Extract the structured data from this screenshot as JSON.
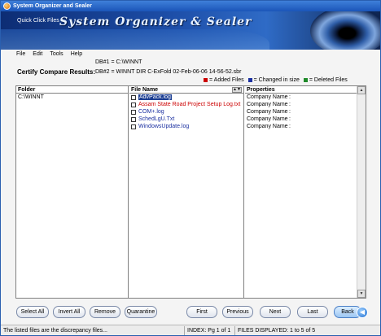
{
  "window": {
    "title": "System Organizer and Sealer"
  },
  "banner": {
    "quick_click_files": "Quick Click Files",
    "brand": "System Organizer & Sealer"
  },
  "menu": [
    "File",
    "Edit",
    "Tools",
    "Help"
  ],
  "info": {
    "db1": "DB#1 = C:\\WINNT",
    "db2": "DB#2 = WINNT DIR C-ExFold 02-Feb-06-06  14-56-52.sbr",
    "certify_label": "Certify Compare Results:",
    "legend": [
      {
        "label": "= Added Files",
        "color": "#cc0000"
      },
      {
        "label": "= Changed in size",
        "color": "#1a2fa0"
      },
      {
        "label": "= Deleted Files",
        "color": "#1f8a2a"
      }
    ]
  },
  "panes": {
    "folder_header": "Folder",
    "file_header": "File Name",
    "props_header": "Properties",
    "folder": "C:\\WINNT",
    "files": [
      {
        "name": "AdvPack.log",
        "color": "#ffffff"
      },
      {
        "name": "Assam State Road Project Setup Log.txt",
        "color": "#cc0000"
      },
      {
        "name": "COM+.log",
        "color": "#1a2fa0"
      },
      {
        "name": "SchedLgU.Txt",
        "color": "#1a2fa0"
      },
      {
        "name": "WindowsUpdate.log",
        "color": "#1a2fa0"
      }
    ],
    "properties": [
      {
        "key": "Company Name",
        "sep": ":"
      },
      {
        "key": "Company Name",
        "sep": ":"
      },
      {
        "key": "Company Name",
        "sep": ":"
      },
      {
        "key": "Company Name",
        "sep": ":"
      },
      {
        "key": "Company Name",
        "sep": ":"
      }
    ]
  },
  "buttons": {
    "select_all": "Select All",
    "invert_all": "Invert All",
    "remove": "Remove",
    "quarantine": "Quarantine",
    "first": "First",
    "previous": "Previous",
    "next": "Next",
    "last": "Last",
    "back": "Back"
  },
  "status": {
    "message": "The listed files are the discrepancy files...",
    "index": "INDEX: Pg 1 of 1",
    "files_displayed": "FILES DISPLAYED:  1  to 5 of 5"
  }
}
